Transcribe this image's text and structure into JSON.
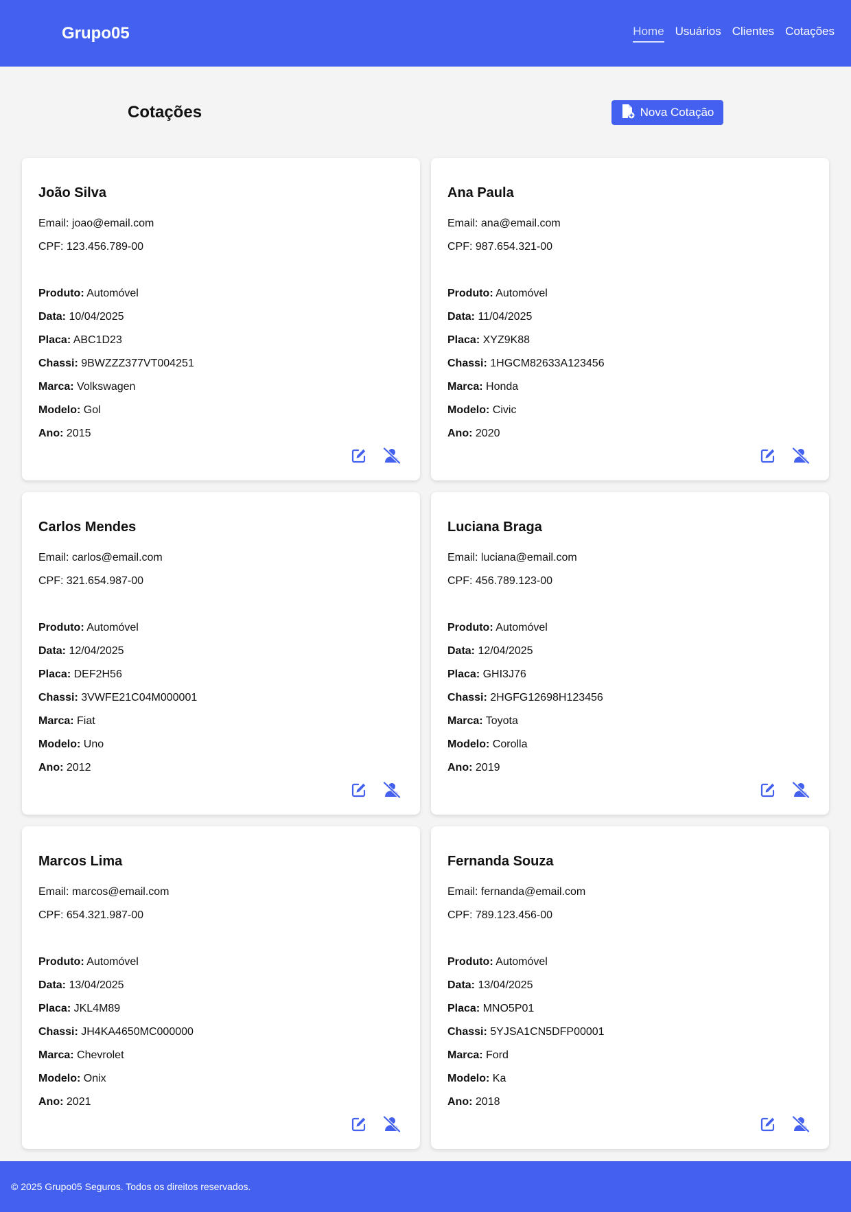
{
  "header": {
    "brand": "Grupo05",
    "nav": [
      {
        "label": "Home",
        "active": true
      },
      {
        "label": "Usuários",
        "active": false
      },
      {
        "label": "Clientes",
        "active": false
      },
      {
        "label": "Cotações",
        "active": false
      }
    ]
  },
  "page": {
    "title": "Cotações",
    "new_button_label": "Nova Cotação",
    "new_button_icon": "file-plus-icon"
  },
  "labels": {
    "email": "Email:",
    "cpf": "CPF:",
    "produto": "Produto:",
    "data": "Data:",
    "placa": "Placa:",
    "chassi": "Chassi:",
    "marca": "Marca:",
    "modelo": "Modelo:",
    "ano": "Ano:"
  },
  "cards": [
    {
      "name": "João Silva",
      "email": "joao@email.com",
      "cpf": "123.456.789-00",
      "produto": "Automóvel",
      "data": "10/04/2025",
      "placa": "ABC1D23",
      "chassi": "9BWZZZ377VT004251",
      "marca": "Volkswagen",
      "modelo": "Gol",
      "ano": "2015"
    },
    {
      "name": "Ana Paula",
      "email": "ana@email.com",
      "cpf": "987.654.321-00",
      "produto": "Automóvel",
      "data": "11/04/2025",
      "placa": "XYZ9K88",
      "chassi": "1HGCM82633A123456",
      "marca": "Honda",
      "modelo": "Civic",
      "ano": "2020"
    },
    {
      "name": "Carlos Mendes",
      "email": "carlos@email.com",
      "cpf": "321.654.987-00",
      "produto": "Automóvel",
      "data": "12/04/2025",
      "placa": "DEF2H56",
      "chassi": "3VWFE21C04M000001",
      "marca": "Fiat",
      "modelo": "Uno",
      "ano": "2012"
    },
    {
      "name": "Luciana Braga",
      "email": "luciana@email.com",
      "cpf": "456.789.123-00",
      "produto": "Automóvel",
      "data": "12/04/2025",
      "placa": "GHI3J76",
      "chassi": "2HGFG12698H123456",
      "marca": "Toyota",
      "modelo": "Corolla",
      "ano": "2019"
    },
    {
      "name": "Marcos Lima",
      "email": "marcos@email.com",
      "cpf": "654.321.987-00",
      "produto": "Automóvel",
      "data": "13/04/2025",
      "placa": "JKL4M89",
      "chassi": "JH4KA4650MC000000",
      "marca": "Chevrolet",
      "modelo": "Onix",
      "ano": "2021"
    },
    {
      "name": "Fernanda Souza",
      "email": "fernanda@email.com",
      "cpf": "789.123.456-00",
      "produto": "Automóvel",
      "data": "13/04/2025",
      "placa": "MNO5P01",
      "chassi": "5YJSA1CN5DFP00001",
      "marca": "Ford",
      "modelo": "Ka",
      "ano": "2018"
    }
  ],
  "card_actions": {
    "edit_icon": "edit-icon",
    "delete_icon": "user-slash-icon"
  },
  "footer": {
    "text": "© 2025 Grupo05 Seguros. Todos os direitos reservados."
  },
  "colors": {
    "primary": "#4361ee",
    "background": "#f4f4f4",
    "card": "#ffffff"
  }
}
